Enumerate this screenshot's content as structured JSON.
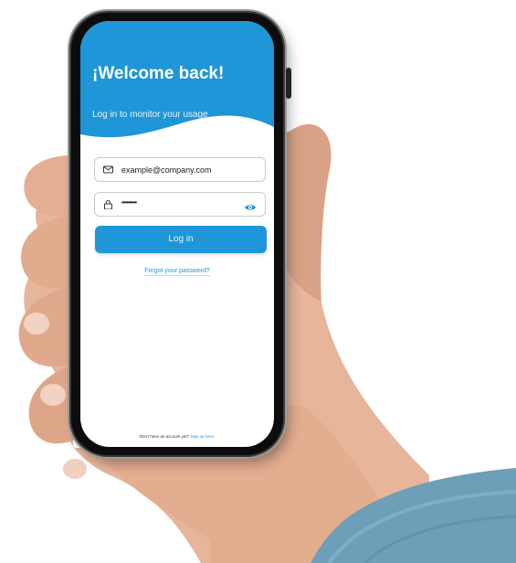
{
  "screen": {
    "welcome_title": "¡Welcome back!",
    "subtitle": "Log in to monitor your usage",
    "email": {
      "value": "example@company.com",
      "icon": "mail-icon"
    },
    "password": {
      "masked_value": "•••••••••",
      "icon": "lock-icon",
      "toggle_icon": "eye-icon"
    },
    "login_button": "Log in",
    "forgot_password": "Forgot your password?",
    "footer": {
      "prompt": "Don't have an account yet?",
      "signup_link": "Sign up here."
    }
  },
  "colors": {
    "primary": "#1e96d8",
    "header_background": "#1e96d8",
    "screen_background": "#ffffff"
  }
}
